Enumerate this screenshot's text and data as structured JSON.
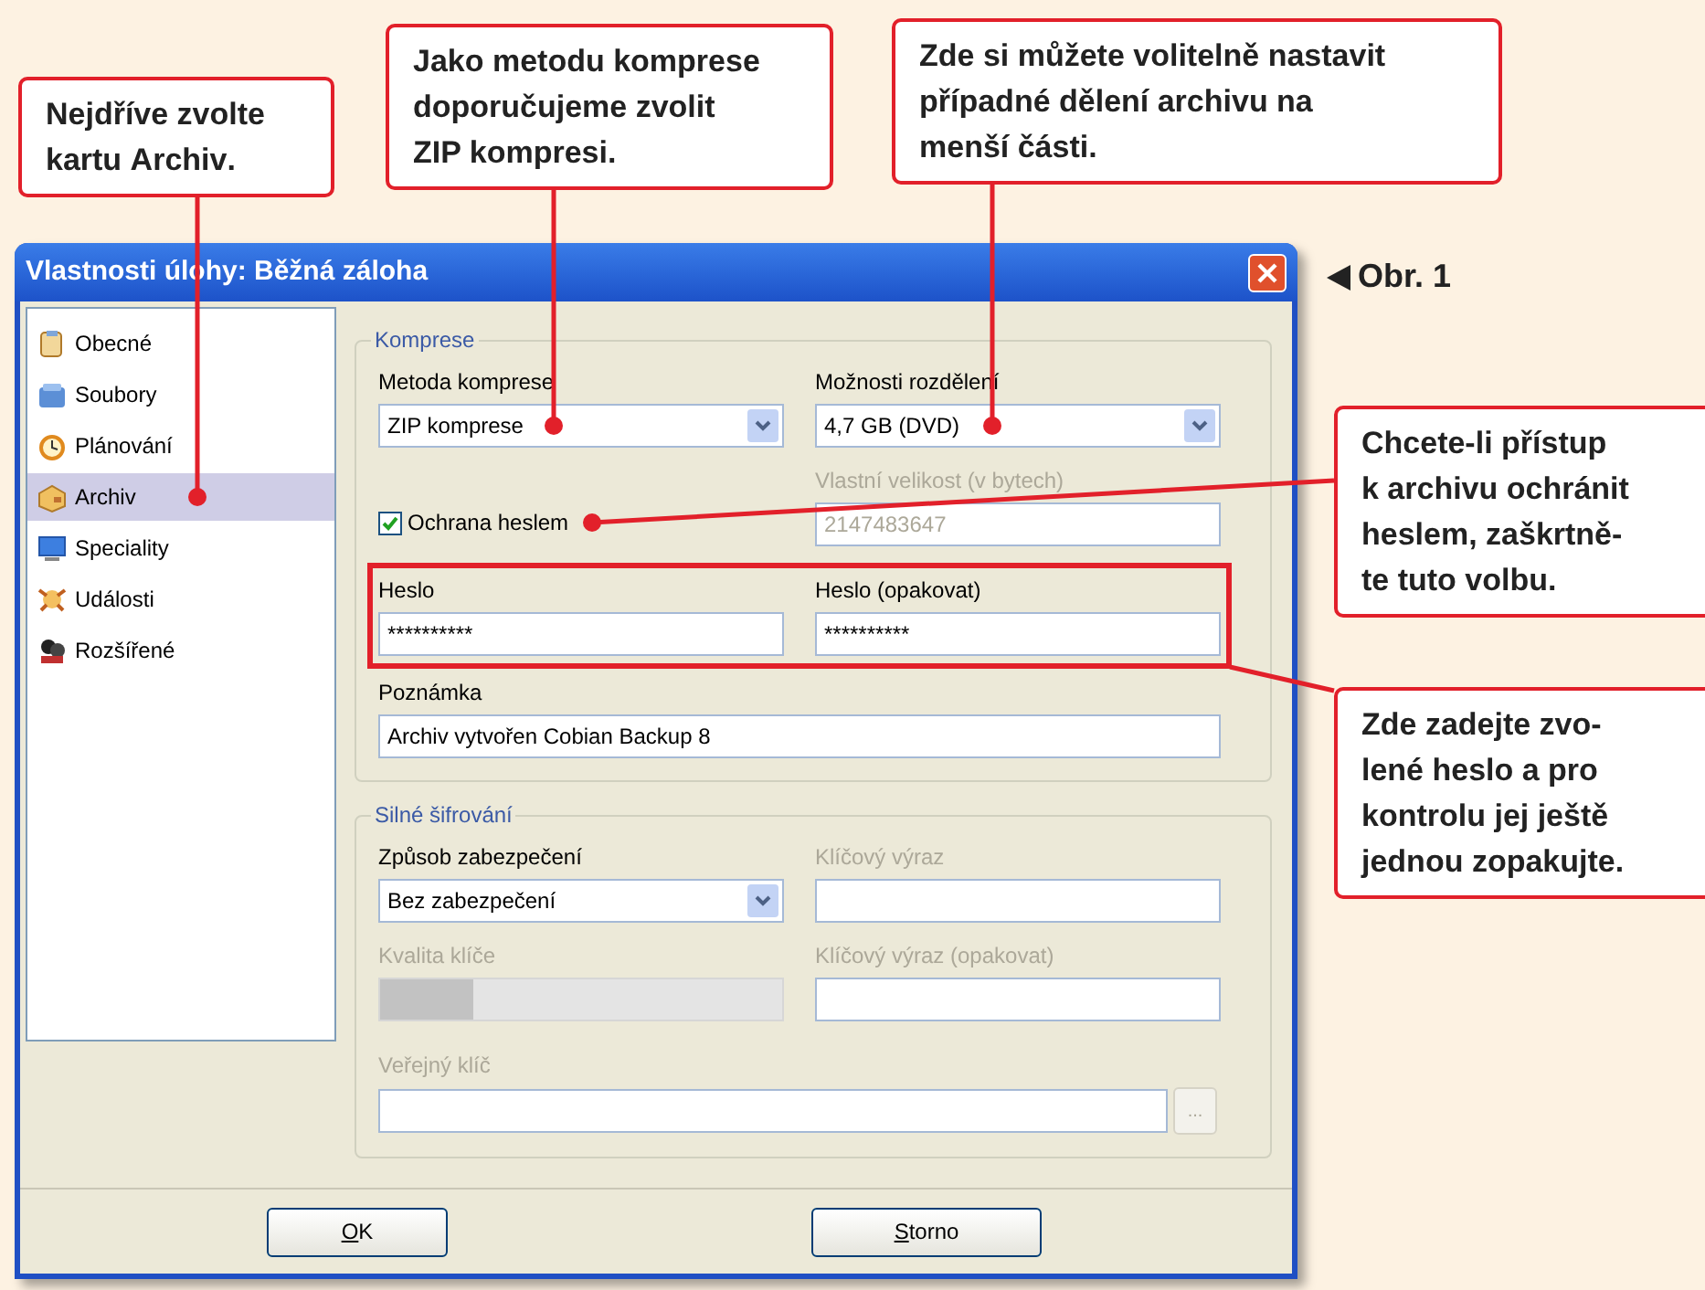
{
  "callouts": [
    {
      "text": "Nejdříve zvolte\nkartu **Archiv**."
    },
    {
      "text": "Jako metodu komprese\ndoporučujeme zvolit\nZIP kompresi."
    },
    {
      "text": "Zde si můžete volitelně nastavit\npřípadné dělení archivu na\nmenší části."
    },
    {
      "text": "Chcete-li přístup\nk archivu ochránit\nheslem, zaškrtně-\nte tuto volbu."
    },
    {
      "text": "Zde zadejte zvo-\nlené heslo a pro\nkontrolu jej ještě\njednou zopakujte."
    }
  ],
  "figure_label": "Obr. 1",
  "window": {
    "title": "Vlastnosti úlohy: Běžná záloha"
  },
  "sidebar": {
    "items": [
      {
        "label": "Obecné",
        "selected": false
      },
      {
        "label": "Soubory",
        "selected": false
      },
      {
        "label": "Plánování",
        "selected": false
      },
      {
        "label": "Archiv",
        "selected": true
      },
      {
        "label": "Speciality",
        "selected": false
      },
      {
        "label": "Události",
        "selected": false
      },
      {
        "label": "Rozšířené",
        "selected": false
      }
    ]
  },
  "compression": {
    "legend": "Komprese",
    "method": {
      "label": "Metoda komprese",
      "value": "ZIP komprese"
    },
    "split": {
      "label": "Možnosti rozdělení",
      "value": "4,7 GB (DVD)"
    },
    "custom_size": {
      "label": "Vlastní velikost (v bytech)",
      "value": "2147483647",
      "disabled": true
    },
    "password_protect": {
      "label": "Ochrana heslem",
      "checked": true
    },
    "password": {
      "label": "Heslo",
      "value": "**********"
    },
    "password_repeat": {
      "label": "Heslo (opakovat)",
      "value": "**********"
    },
    "note": {
      "label": "Poznámka",
      "value": "Archiv vytvořen Cobian Backup 8"
    }
  },
  "encryption": {
    "legend": "Silné šifrování",
    "mode": {
      "label": "Způsob zabezpečení",
      "value": "Bez zabezpečení"
    },
    "passphrase": {
      "label": "Klíčový výraz",
      "disabled": true
    },
    "key_quality": {
      "label": "Kvalita klíče",
      "disabled": true,
      "level": 0.23
    },
    "passphrase_repeat": {
      "label": "Klíčový výraz (opakovat)",
      "disabled": true
    },
    "public_key": {
      "label": "Veřejný klíč",
      "disabled": true,
      "browse": "..."
    }
  },
  "buttons": [
    {
      "label": "OK"
    },
    {
      "label": "Storno"
    }
  ]
}
